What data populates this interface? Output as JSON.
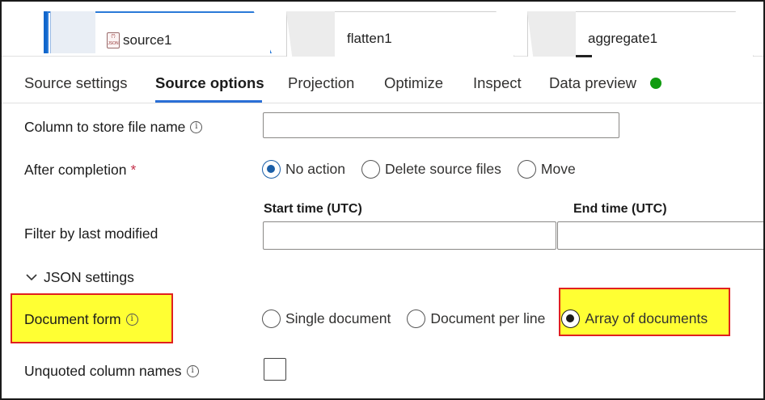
{
  "nodes": [
    {
      "label": "source1",
      "icon": "json-file-icon",
      "icon_text_top": "{*}",
      "icon_text_bottom": "JSON"
    },
    {
      "label": "flatten1"
    },
    {
      "label": "aggregate1"
    }
  ],
  "tabs": [
    {
      "label": "Source settings"
    },
    {
      "label": "Source options"
    },
    {
      "label": "Projection"
    },
    {
      "label": "Optimize"
    },
    {
      "label": "Inspect"
    },
    {
      "label": "Data preview"
    }
  ],
  "active_tab": "Source options",
  "form": {
    "column_file_name": {
      "label": "Column to store file name",
      "value": ""
    },
    "after_completion": {
      "label": "After completion",
      "required_marker": "*",
      "options": [
        "No action",
        "Delete source files",
        "Move"
      ],
      "selected": "No action"
    },
    "filter_last_modified": {
      "label": "Filter by last modified",
      "start_label": "Start time (UTC)",
      "end_label": "End time (UTC)",
      "start_value": "",
      "end_value": ""
    },
    "json_settings": {
      "label": "JSON settings"
    },
    "document_form": {
      "label": "Document form",
      "options": [
        "Single document",
        "Document per line",
        "Array of documents"
      ],
      "selected": "Array of documents"
    },
    "unquoted_column_names": {
      "label": "Unquoted column names",
      "checked": false
    }
  },
  "colors": {
    "accent": "#2a6fd6",
    "status_dot": "#109b10",
    "highlight_fill": "#ffff33",
    "highlight_border": "#e02020"
  }
}
